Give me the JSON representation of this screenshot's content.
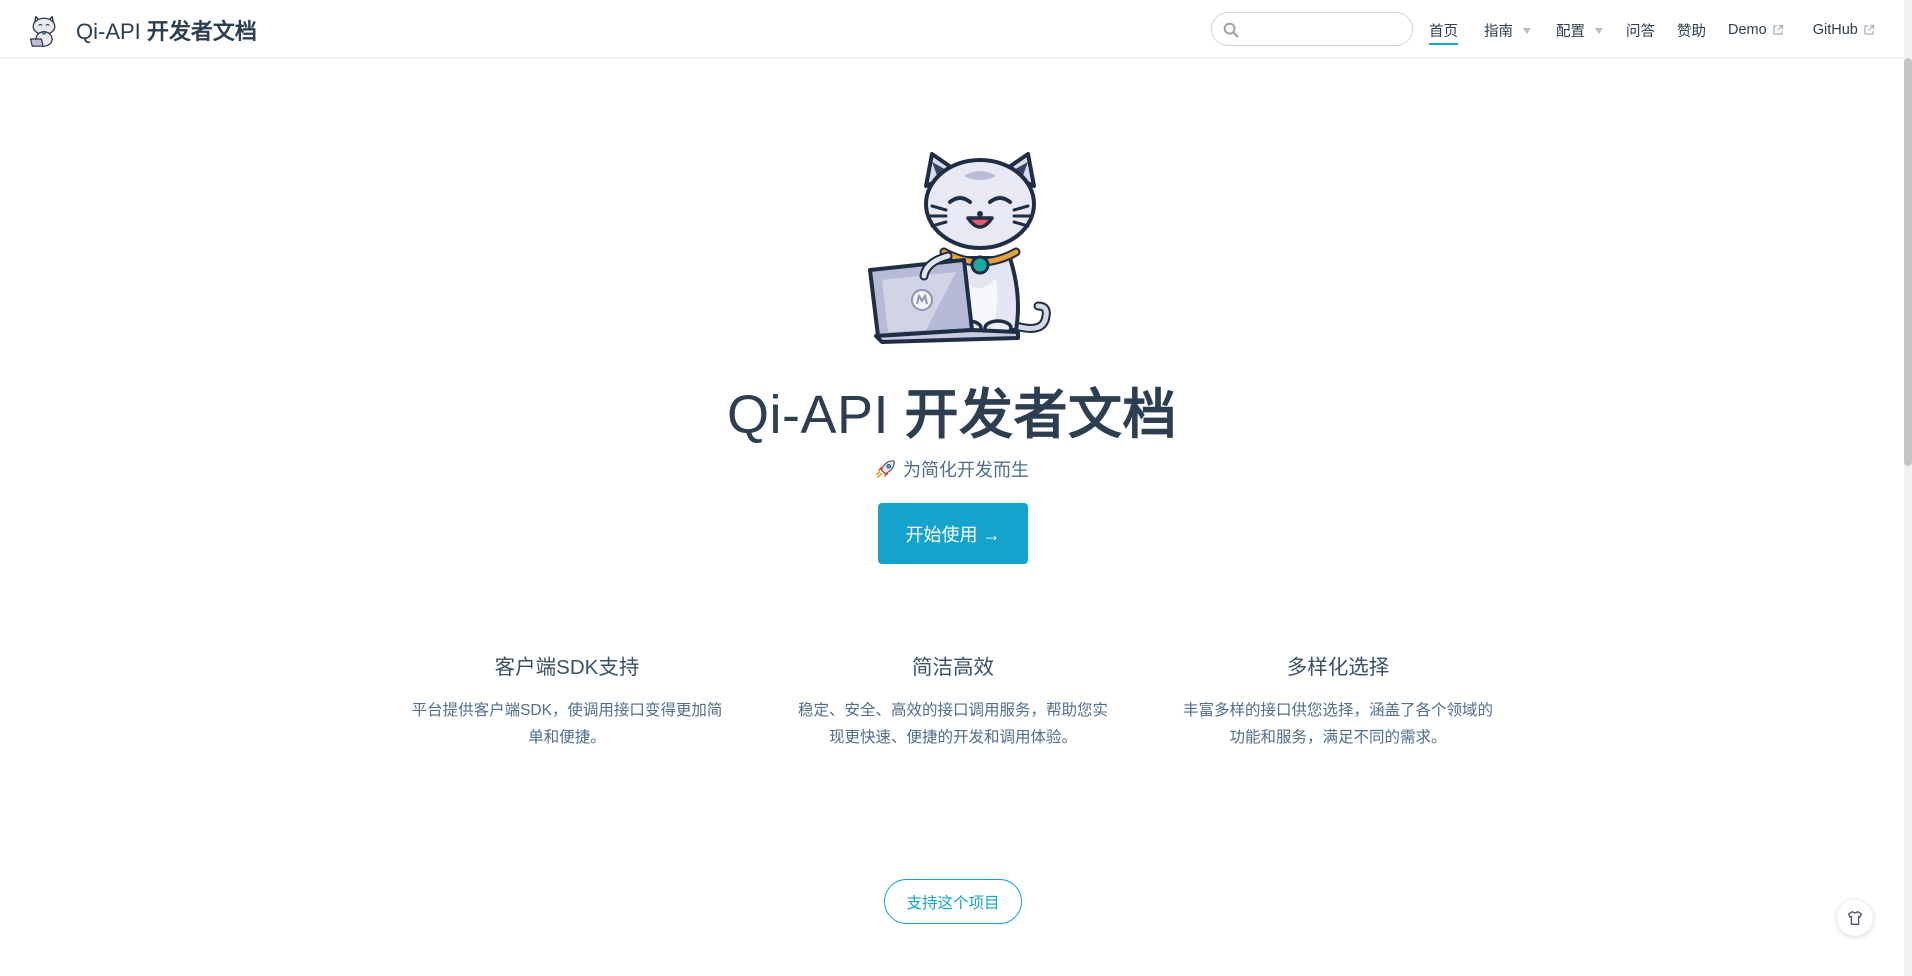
{
  "brand": {
    "latin": "Qi-API",
    "cjk": " 开发者文档",
    "logo_icon": "cat-logo-icon"
  },
  "search": {
    "placeholder": "",
    "value": ""
  },
  "nav": {
    "home": "首页",
    "guide": "指南",
    "config": "配置",
    "faq": "问答",
    "sponsor": "赞助",
    "demo": "Demo",
    "github": "GitHub"
  },
  "hero": {
    "title_latin": "Qi-API",
    "title_cjk": " 开发者文档",
    "description": "为简化开发而生",
    "action": "开始使用 →"
  },
  "features": [
    {
      "title": "客户端SDK支持",
      "details": "平台提供客户端SDK，使调用接口变得更加简单和便捷。"
    },
    {
      "title": "简洁高效",
      "details": "稳定、安全、高效的接口调用服务，帮助您实现更快速、便捷的开发和调用体验。"
    },
    {
      "title": "多样化选择",
      "details": "丰富多样的接口供您选择，涵盖了各个领域的功能和服务，满足不同的需求。"
    }
  ],
  "footer": {
    "support": "支持这个项目"
  },
  "colors": {
    "accent": "#14a3cc",
    "text": "#2c3e50",
    "muted": "#4e6e8e"
  }
}
